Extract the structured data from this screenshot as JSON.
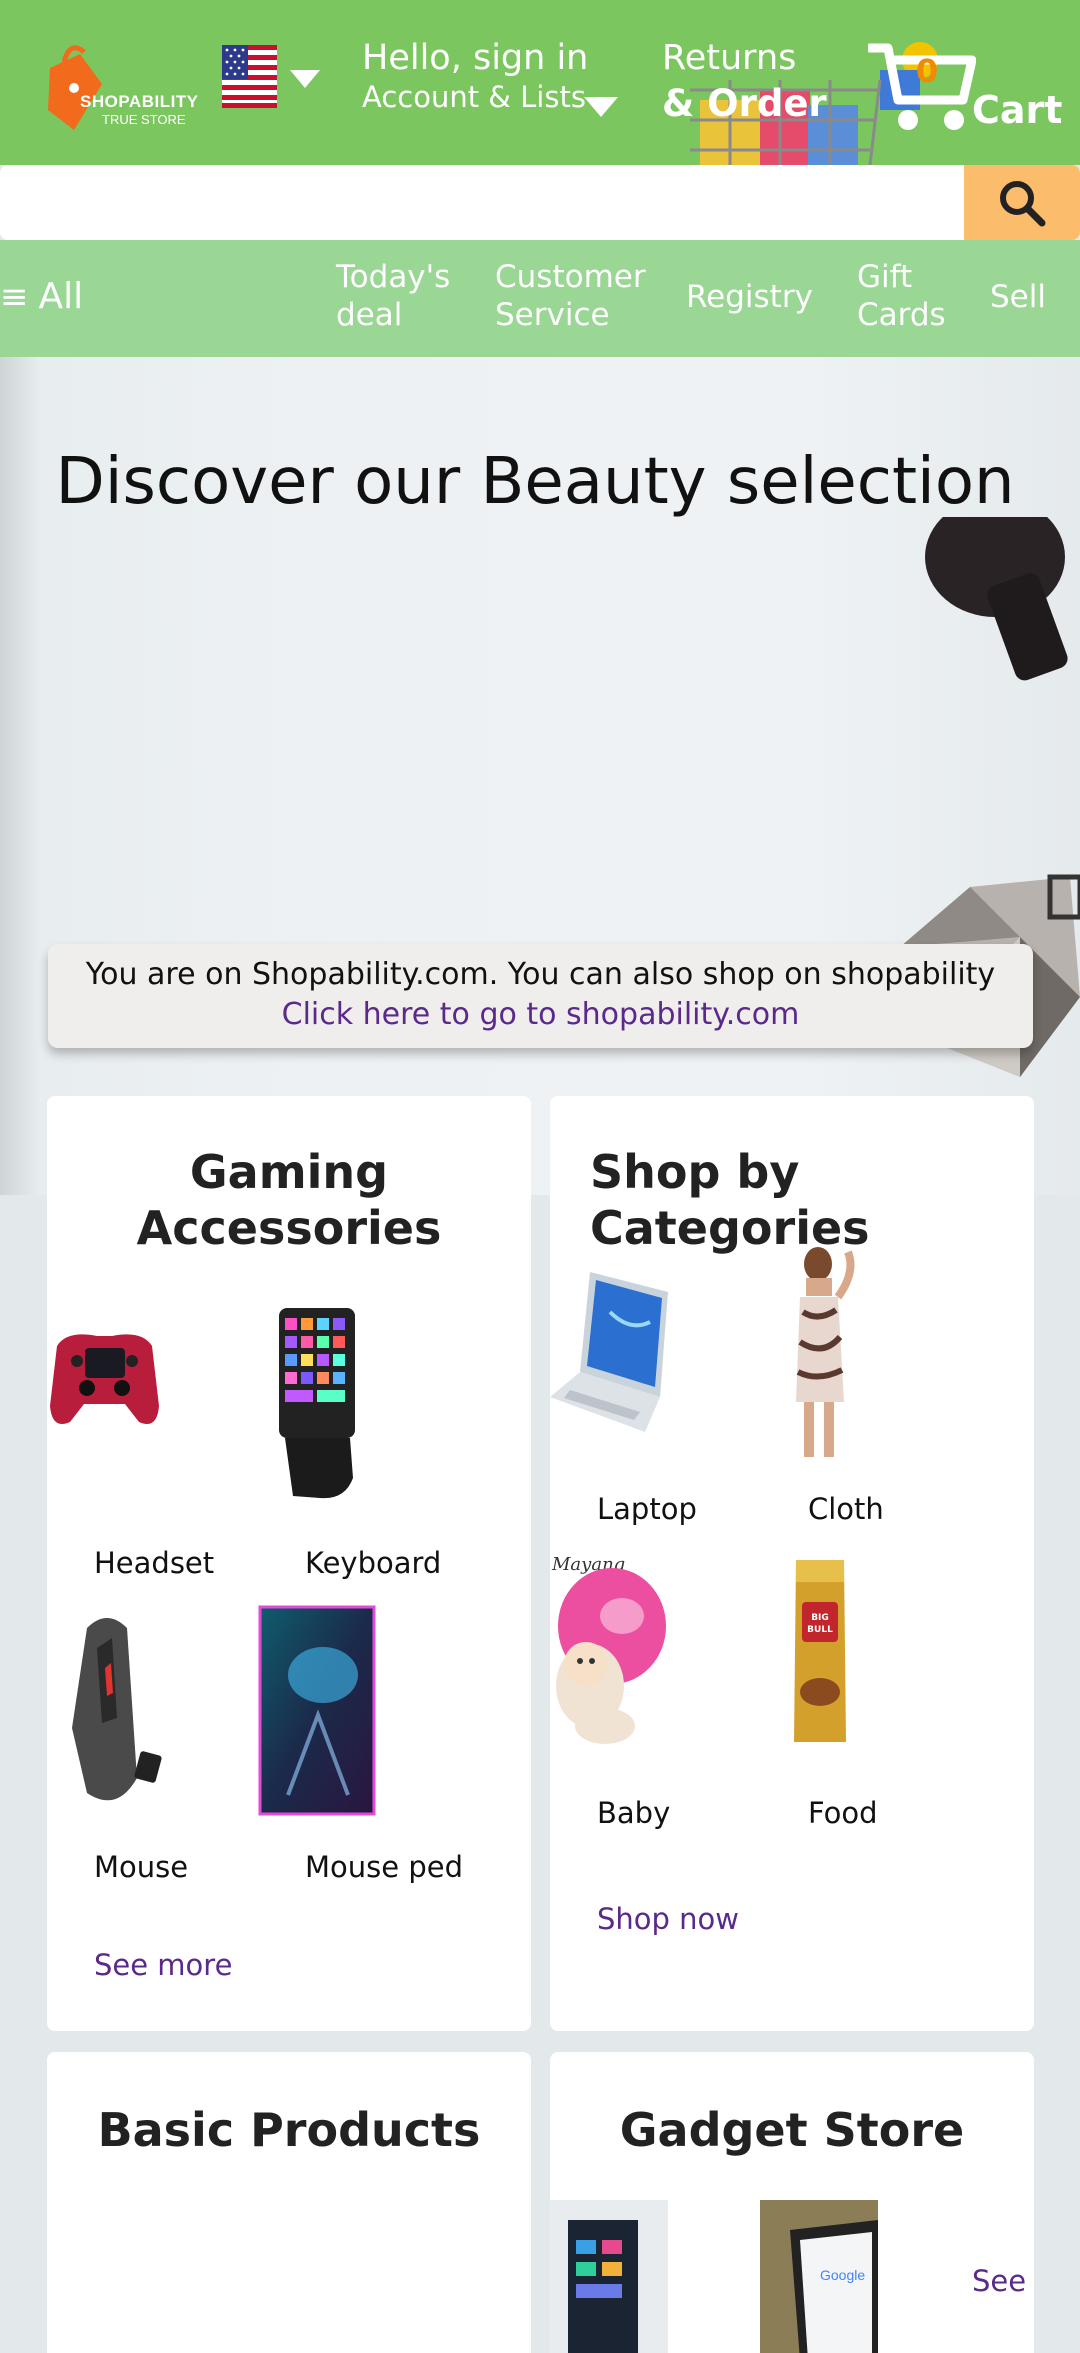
{
  "header": {
    "logo_text": "SHOPABILITY",
    "logo_subtext": "TRUE STORE",
    "greeting": "Hello, sign in",
    "account_label": "Account & Lists",
    "returns_label": "Returns",
    "orders_label": "& Order",
    "cart_count": "0",
    "cart_label": "Cart",
    "colors": {
      "bar": "#7cc660",
      "accent": "#f08a00"
    }
  },
  "search": {
    "placeholder": "",
    "value": "",
    "button_color": "#fbbd6c"
  },
  "nav": {
    "all_label": "All",
    "items": [
      "Today's deal",
      "Customer Service",
      "Registry",
      "Gift Cards",
      "Sell"
    ]
  },
  "hero": {
    "title": "Discover our Beauty selection"
  },
  "notice": {
    "text": "You are on Shopability.com. You can also shop on shopability ",
    "link_text": "Click here to go to shopability.com"
  },
  "cards": {
    "gaming": {
      "title": "Gaming Accessories",
      "items": [
        {
          "label": "Headset",
          "icon": "gamepad-image"
        },
        {
          "label": "Keyboard",
          "icon": "keyboard-image"
        },
        {
          "label": "Mouse",
          "icon": "mouse-image"
        },
        {
          "label": "Mouse ped",
          "icon": "mousepad-image"
        }
      ],
      "link": "See more"
    },
    "categories": {
      "title": "Shop by Categories",
      "items": [
        {
          "label": "Laptop",
          "icon": "laptop-image"
        },
        {
          "label": "Cloth",
          "icon": "dress-image"
        },
        {
          "label": "Baby",
          "icon": "baby-image"
        },
        {
          "label": "Food",
          "icon": "food-pack-image"
        }
      ],
      "link": "Shop now",
      "baby_watermark": "Mayang"
    },
    "basic": {
      "title": "Basic Products"
    },
    "gadget": {
      "title": "Gadget Store",
      "link": "See",
      "tablet_screen_text": "Google"
    }
  }
}
